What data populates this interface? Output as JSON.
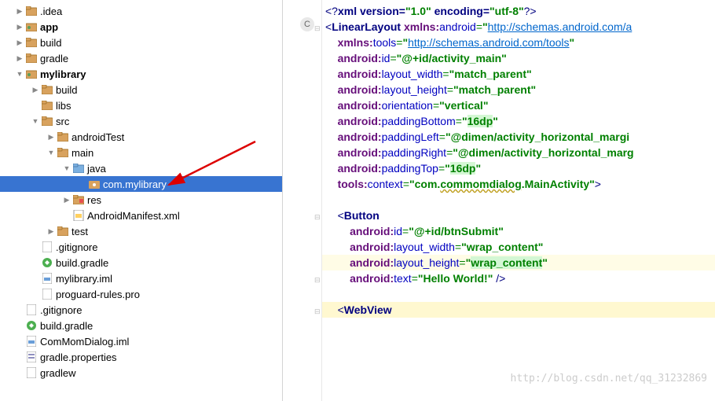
{
  "tree": {
    "idea": ".idea",
    "app": "app",
    "build": "build",
    "gradle": "gradle",
    "mylibrary": "mylibrary",
    "mybuild": "build",
    "libs": "libs",
    "src": "src",
    "androidTest": "androidTest",
    "main": "main",
    "java": "java",
    "pkg": "com.mylibrary",
    "res": "res",
    "manifest": "AndroidManifest.xml",
    "test": "test",
    "gitignore": ".gitignore",
    "buildgradle": "build.gradle",
    "iml": "mylibrary.iml",
    "proguard": "proguard-rules.pro",
    "rootgit": ".gitignore",
    "rootbuild": "build.gradle",
    "rootiml": "ComMomDialog.iml",
    "gradleprops": "gradle.properties",
    "gradlew": "gradlew"
  },
  "code": {
    "l1": {
      "a": "<?",
      "b": "xml version=",
      "c": "\"1.0\"",
      "d": " encoding=",
      "e": "\"utf-8\"",
      "f": "?>"
    },
    "l2": {
      "a": "<",
      "b": "LinearLayout ",
      "c": "xmlns:",
      "d": "android",
      "e": "=",
      "f": "\"",
      "g": "http://schemas.android.com/a"
    },
    "l3": {
      "a": "xmlns:",
      "b": "tools",
      "c": "=",
      "d": "\"",
      "e": "http://schemas.android.com/tools",
      "f": "\""
    },
    "l4": {
      "a": "android:",
      "b": "id",
      "c": "=",
      "d": "\"@+id/activity_main\""
    },
    "l5": {
      "a": "android:",
      "b": "layout_width",
      "c": "=",
      "d": "\"match_parent\""
    },
    "l6": {
      "a": "android:",
      "b": "layout_height",
      "c": "=",
      "d": "\"match_parent\""
    },
    "l7": {
      "a": "android:",
      "b": "orientation",
      "c": "=",
      "d": "\"vertical\""
    },
    "l8": {
      "a": "android:",
      "b": "paddingBottom",
      "c": "=",
      "d": "\"",
      "e": "16dp",
      "f": "\""
    },
    "l9": {
      "a": "android:",
      "b": "paddingLeft",
      "c": "=",
      "d": "\"@dimen/activity_horizontal_margi"
    },
    "l10": {
      "a": "android:",
      "b": "paddingRight",
      "c": "=",
      "d": "\"@dimen/activity_horizontal_marg"
    },
    "l11": {
      "a": "android:",
      "b": "paddingTop",
      "c": "=",
      "d": "\"",
      "e": "16dp",
      "f": "\""
    },
    "l12": {
      "a": "tools:",
      "b": "context",
      "c": "=",
      "d": "\"com.",
      "e": "commomdialog",
      "f": ".MainActivity\"",
      "g": ">"
    },
    "l14": {
      "a": "<",
      "b": "Button"
    },
    "l15": {
      "a": "android:",
      "b": "id",
      "c": "=",
      "d": "\"@+id/btnSubmit\""
    },
    "l16": {
      "a": "android:",
      "b": "layout_width",
      "c": "=",
      "d": "\"wrap_content\""
    },
    "l17": {
      "a": "android:",
      "b": "layout_height",
      "c": "=",
      "d": "\"",
      "e": "wrap_content",
      "f": "\""
    },
    "l18": {
      "a": "android:",
      "b": "text",
      "c": "=",
      "d": "\"Hello World!\"",
      "e": " />"
    },
    "l20": {
      "a": "<",
      "b": "WebView"
    }
  },
  "chart_data": null,
  "watermark": "http://blog.csdn.net/qq_31232869"
}
